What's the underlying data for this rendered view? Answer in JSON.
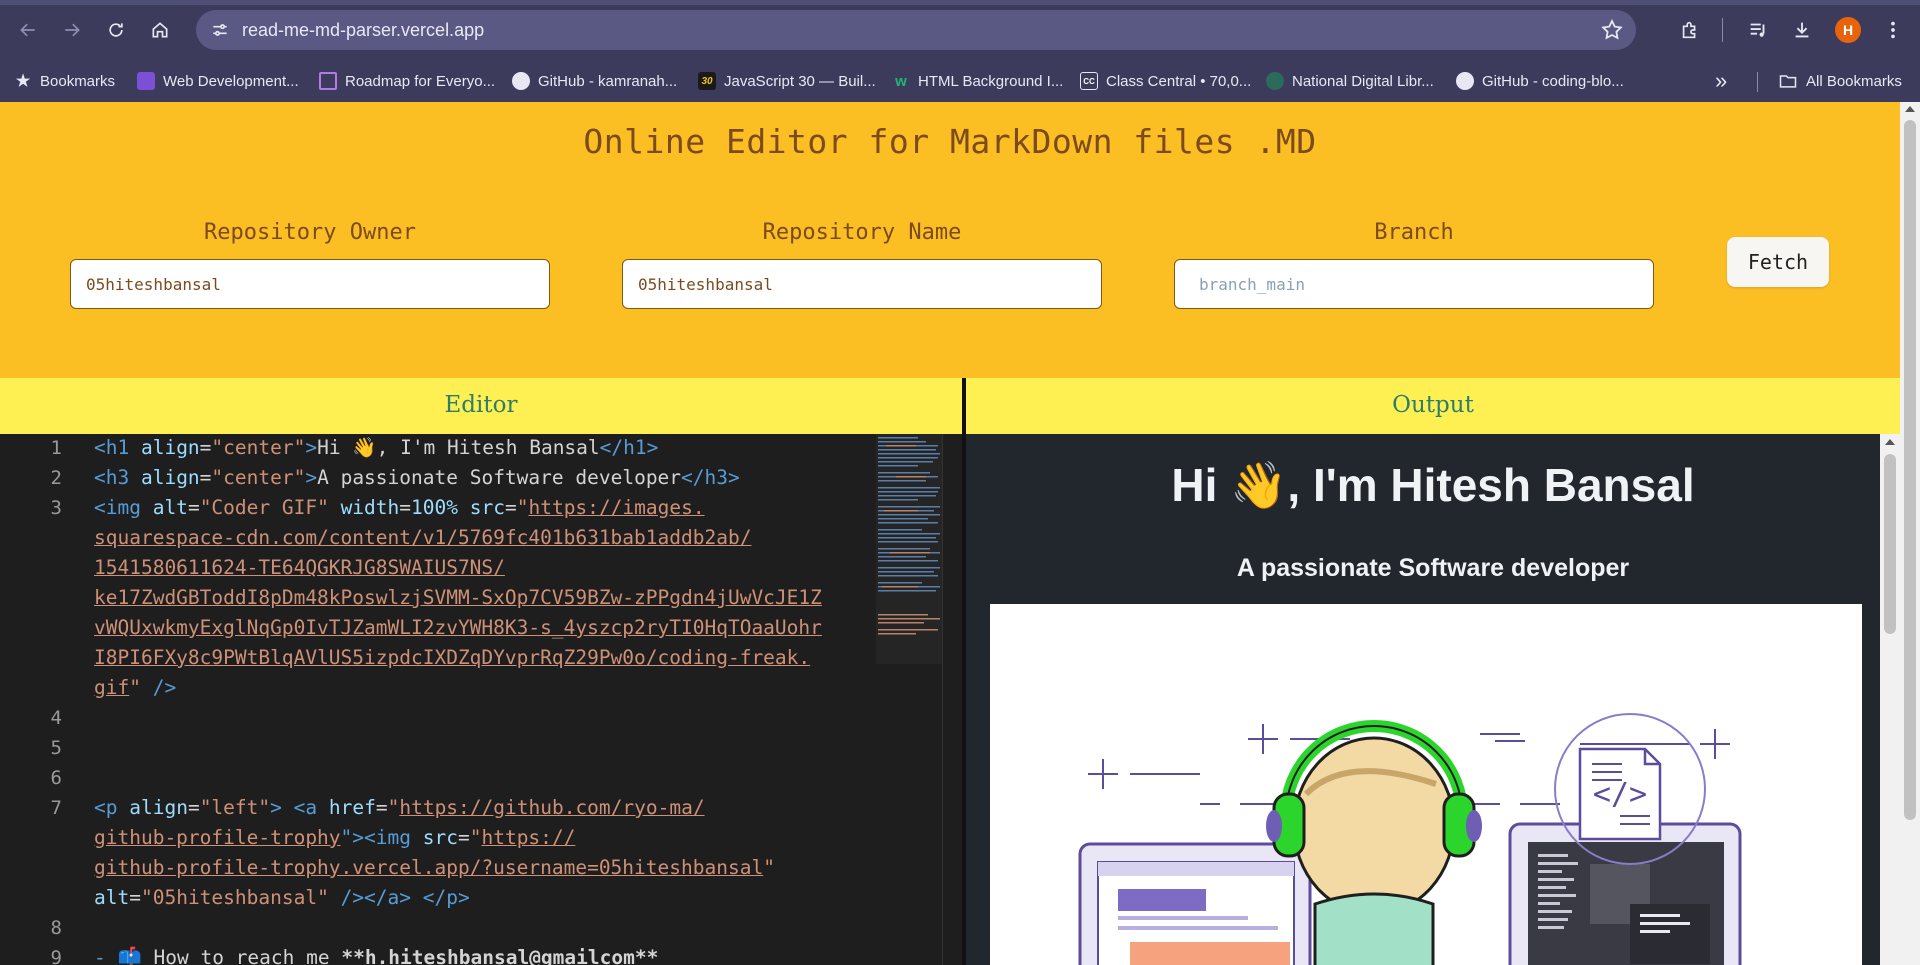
{
  "browser": {
    "url": "read-me-md-parser.vercel.app",
    "profile_initial": "H",
    "bookmarks": [
      {
        "label": "Bookmarks",
        "icon": "star-icon"
      },
      {
        "label": "Web Development...",
        "icon": "web-dev-icon"
      },
      {
        "label": "Roadmap for Everyo...",
        "icon": "roadmap-icon"
      },
      {
        "label": "GitHub - kamranah...",
        "icon": "github-icon"
      },
      {
        "label": "JavaScript 30 — Buil...",
        "icon": "js30-icon",
        "badge": "30"
      },
      {
        "label": "HTML Background I...",
        "icon": "w-icon"
      },
      {
        "label": "Class Central • 70,0...",
        "icon": "class-central-icon",
        "badge": "CC"
      },
      {
        "label": "National Digital Libr...",
        "icon": "ndl-icon"
      },
      {
        "label": "GitHub - coding-blo...",
        "icon": "github-icon"
      }
    ],
    "all_bookmarks": "All Bookmarks",
    "colors": {
      "chrome": "#3c3b5c",
      "omnibox": "#5a5983",
      "profile": "#e8640c"
    }
  },
  "app": {
    "title": "Online Editor for MarkDown files .MD",
    "fields": [
      {
        "label": "Repository Owner",
        "value": "05hiteshbansal",
        "placeholder": ""
      },
      {
        "label": "Repository Name",
        "value": "05hiteshbansal",
        "placeholder": ""
      },
      {
        "label": "Branch",
        "value": "",
        "placeholder": "branch_main"
      }
    ],
    "fetch_label": "Fetch",
    "editor_label": "Editor",
    "output_label": "Output",
    "colors": {
      "header_bg": "#fbbf24",
      "panel_head_bg": "#fef052",
      "panel_label": "#2d7d6a",
      "title": "#7c4a1d"
    }
  },
  "editor": {
    "line_numbers": [
      "1",
      "2",
      "3",
      "4",
      "5",
      "6",
      "7",
      "8",
      "9"
    ],
    "l1": {
      "open": "<h1 ",
      "attr": "align",
      "eq": "=",
      "val": "\"center\"",
      "close": ">",
      "text": "Hi 👋, I'm Hitesh Bansal",
      "end": "</h1>"
    },
    "l2": {
      "open": "<h3 ",
      "attr": "align",
      "eq": "=",
      "val": "\"center\"",
      "close": ">",
      "text": "A passionate Software developer",
      "end": "</h3>"
    },
    "l3": {
      "open": "<img ",
      "attr1": "alt",
      "eq1": "=",
      "val1": "\"Coder GIF\"",
      "attr2": "  width",
      "eq2": "=",
      "val2": "100%",
      "attr3": " src",
      "eq3": "=",
      "q": "\"",
      "url_lines": [
        "https://images.",
        "squarespace-cdn.com/content/v1/5769fc401b631bab1addb2ab/",
        "1541580611624-TE64QGKRJG8SWAIUS7NS/",
        "ke17ZwdGBToddI8pDm48kPoswlzjSVMM-SxOp7CV59BZw-zPPgdn4jUwVcJE1Z",
        "vWQUxwkmyExglNqGp0IvTJZamWLI2zvYWH8K3-s_4yszcp2ryTI0HqTOaaUohr",
        "I8PI6FXy8c9PWtBlqAVlUS5izpdcIXDZqDYvprRqZ29Pw0o/coding-freak.",
        "gif"
      ],
      "end_q": "\"",
      "end": " />"
    },
    "l7": {
      "p_open": "<p ",
      "p_attr": "align",
      "p_eq": "=",
      "p_val": "\"left\"",
      "p_close": ">",
      "sp": " ",
      "a_open": "<a ",
      "a_attr": "href",
      "a_eq": "=",
      "q": "\"",
      "href1": "https://github.com/ryo-ma/",
      "href2": "github-profile-trophy",
      "a_close": "\">",
      "img_open": "<img ",
      "img_attr": "src",
      "img_eq": "=",
      "src1": "https://",
      "src2": "github-profile-trophy.vercel.app/?username=05hiteshbansal",
      "src_end": "\"",
      "alt_attr": "alt",
      "alt_eq": "=",
      "alt_val": "\"05hiteshbansal\"",
      "tail": " /></a> </p>"
    },
    "l9": {
      "prefix": "- 📫 ",
      "text": "How to reach me ",
      "bold": "**h.hiteshbansal@gmailcom**"
    }
  },
  "output": {
    "h1": "Hi 👋, I'm Hitesh Bansal",
    "h3": "A passionate Software developer",
    "image_alt": "Coder GIF",
    "colors": {
      "bg": "#22272e",
      "text": "#f0f3f6",
      "headphones": "#2bd52b",
      "accent": "#6e5fb5"
    }
  }
}
